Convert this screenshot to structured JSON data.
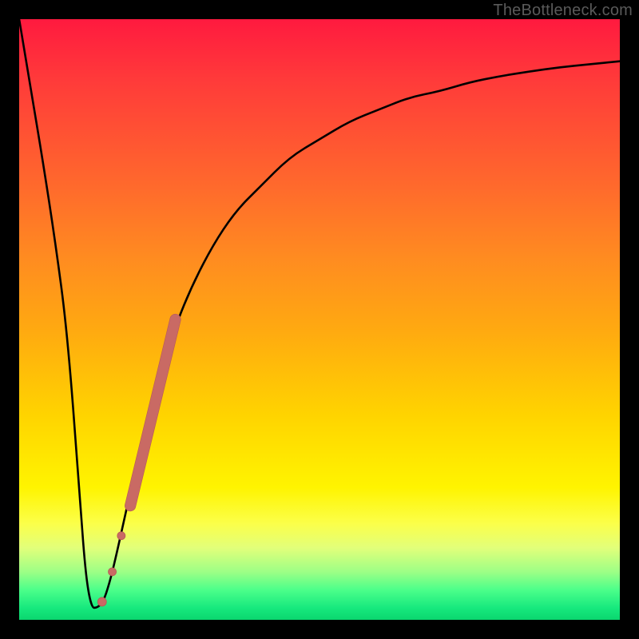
{
  "watermark": "TheBottleneck.com",
  "colors": {
    "curve": "#000000",
    "marker_fill": "#c96a64",
    "marker_stroke": "#b85a56",
    "frame": "#000000"
  },
  "chart_data": {
    "type": "line",
    "title": "",
    "xlabel": "",
    "ylabel": "",
    "xlim": [
      0,
      100
    ],
    "ylim": [
      0,
      100
    ],
    "series": [
      {
        "name": "bottleneck-curve",
        "x": [
          0,
          2,
          4,
          6,
          8,
          10,
          11,
          12,
          13,
          14,
          15,
          16,
          18,
          20,
          22,
          25,
          28,
          32,
          36,
          40,
          45,
          50,
          55,
          60,
          65,
          70,
          75,
          80,
          85,
          90,
          95,
          100
        ],
        "y": [
          100,
          88,
          76,
          63,
          48,
          22,
          8,
          2,
          2,
          3,
          6,
          10,
          19,
          28,
          36,
          46,
          54,
          62,
          68,
          72,
          77,
          80,
          83,
          85,
          87,
          88,
          89.5,
          90.5,
          91.3,
          92,
          92.5,
          93
        ]
      }
    ],
    "markers": [
      {
        "name": "marker-segment",
        "x0": 18.5,
        "y0": 19,
        "x1": 26.0,
        "y1": 50,
        "r": 6.5
      },
      {
        "name": "marker-dot-1",
        "x": 17.0,
        "y": 14,
        "r": 5.0
      },
      {
        "name": "marker-dot-2",
        "x": 15.5,
        "y": 8,
        "r": 5.0
      },
      {
        "name": "marker-dot-3",
        "x": 13.8,
        "y": 3,
        "r": 5.5
      }
    ],
    "annotations": []
  }
}
